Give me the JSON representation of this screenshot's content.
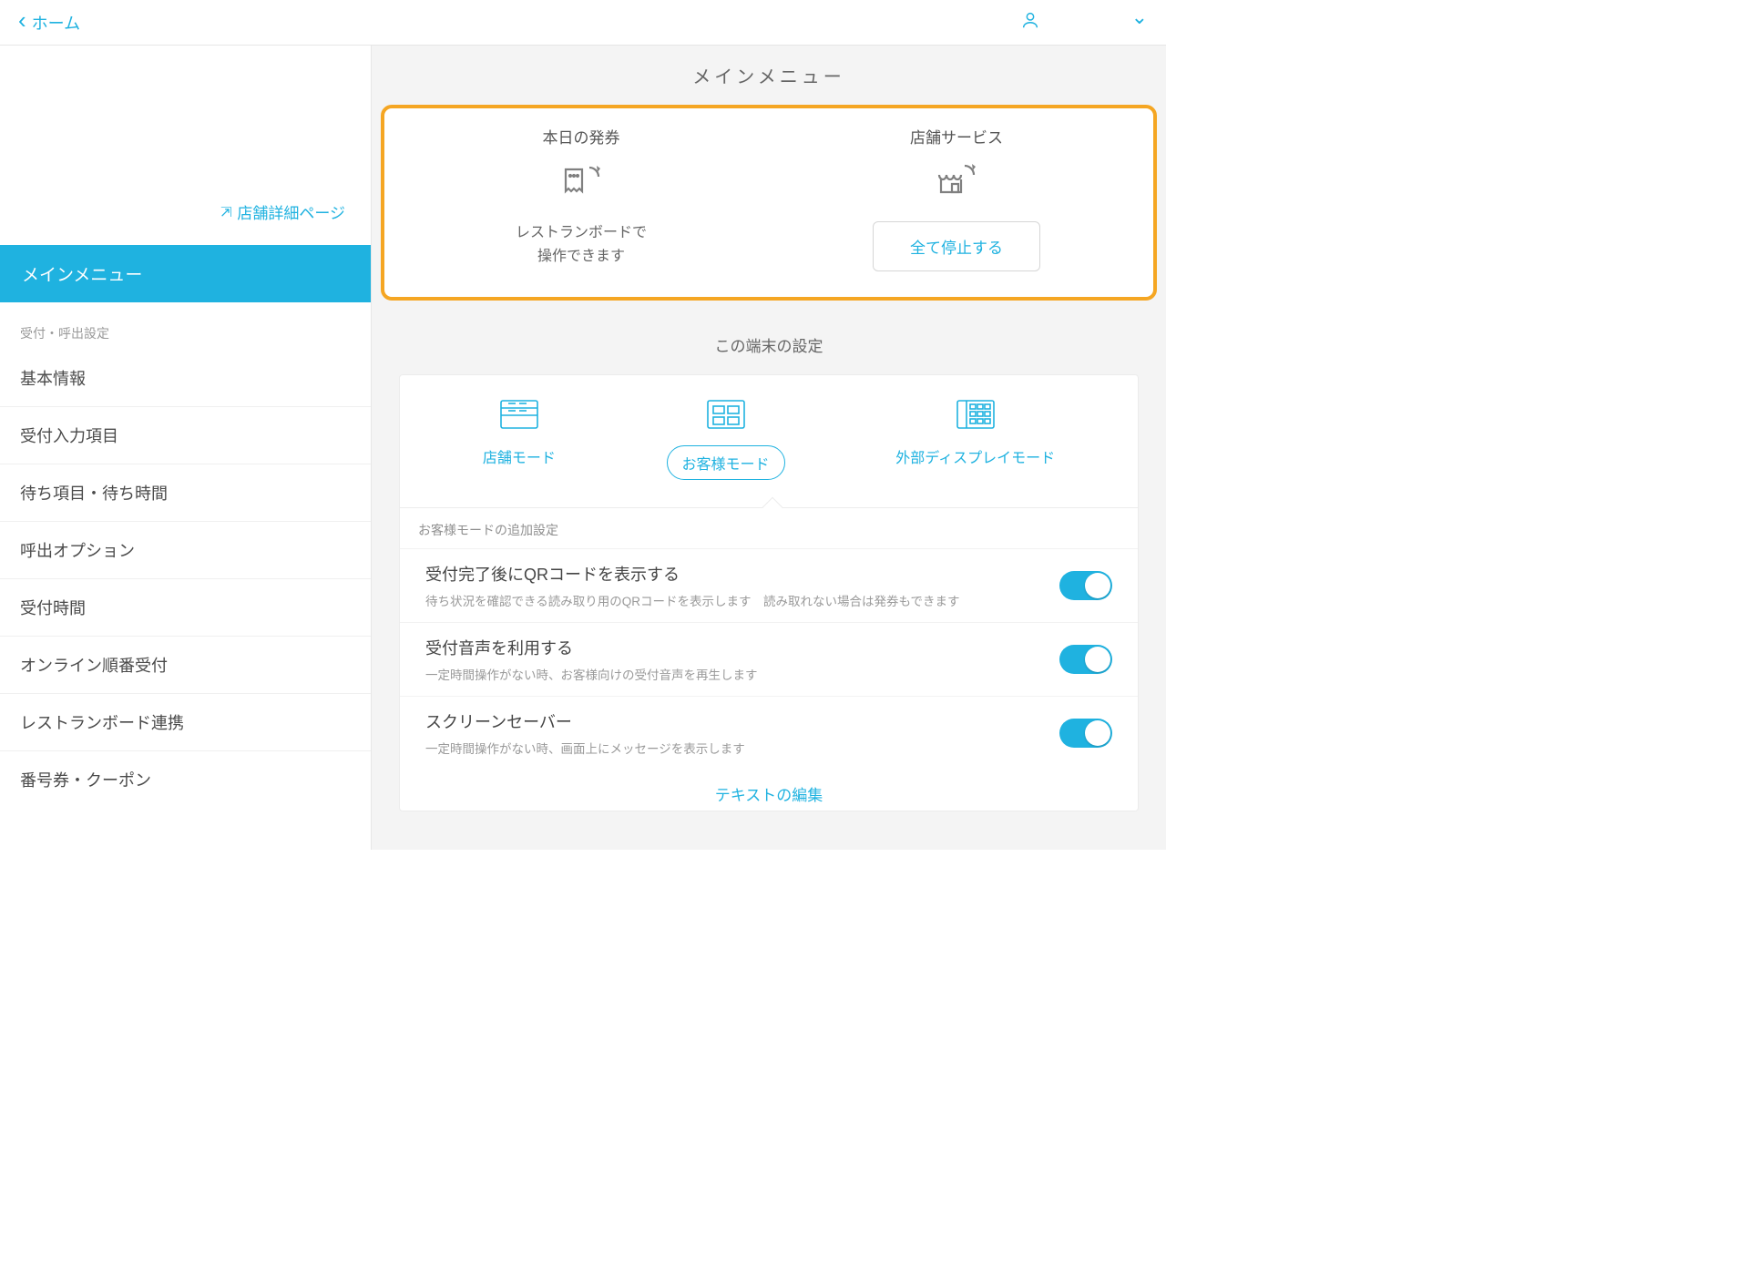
{
  "topbar": {
    "back_label": "ホーム"
  },
  "sidebar": {
    "store_link": "店舗詳細ページ",
    "active": "メインメニュー",
    "section_label": "受付・呼出設定",
    "items": [
      "基本情報",
      "受付入力項目",
      "待ち項目・待ち時間",
      "呼出オプション",
      "受付時間",
      "オンライン順番受付",
      "レストランボード連携",
      "番号券・クーポン"
    ]
  },
  "main": {
    "title": "メインメニュー",
    "highlight": {
      "left_title": "本日の発券",
      "left_note_line1": "レストランボードで",
      "left_note_line2": "操作できます",
      "right_title": "店舗サービス",
      "right_button": "全て停止する"
    },
    "device_title": "この端末の設定",
    "modes": {
      "store": "店舗モード",
      "customer": "お客様モード",
      "external": "外部ディスプレイモード"
    },
    "settings_header": "お客様モードの追加設定",
    "settings": [
      {
        "title": "受付完了後にQRコードを表示する",
        "desc": "待ち状況を確認できる読み取り用のQRコードを表示します　読み取れない場合は発券もできます",
        "on": true
      },
      {
        "title": "受付音声を利用する",
        "desc": "一定時間操作がない時、お客様向けの受付音声を再生します",
        "on": true
      },
      {
        "title": "スクリーンセーバー",
        "desc": "一定時間操作がない時、画面上にメッセージを表示します",
        "on": true
      }
    ],
    "edit_link": "テキストの編集"
  },
  "colors": {
    "accent": "#1fb2e0",
    "highlight_border": "#f5a623"
  }
}
